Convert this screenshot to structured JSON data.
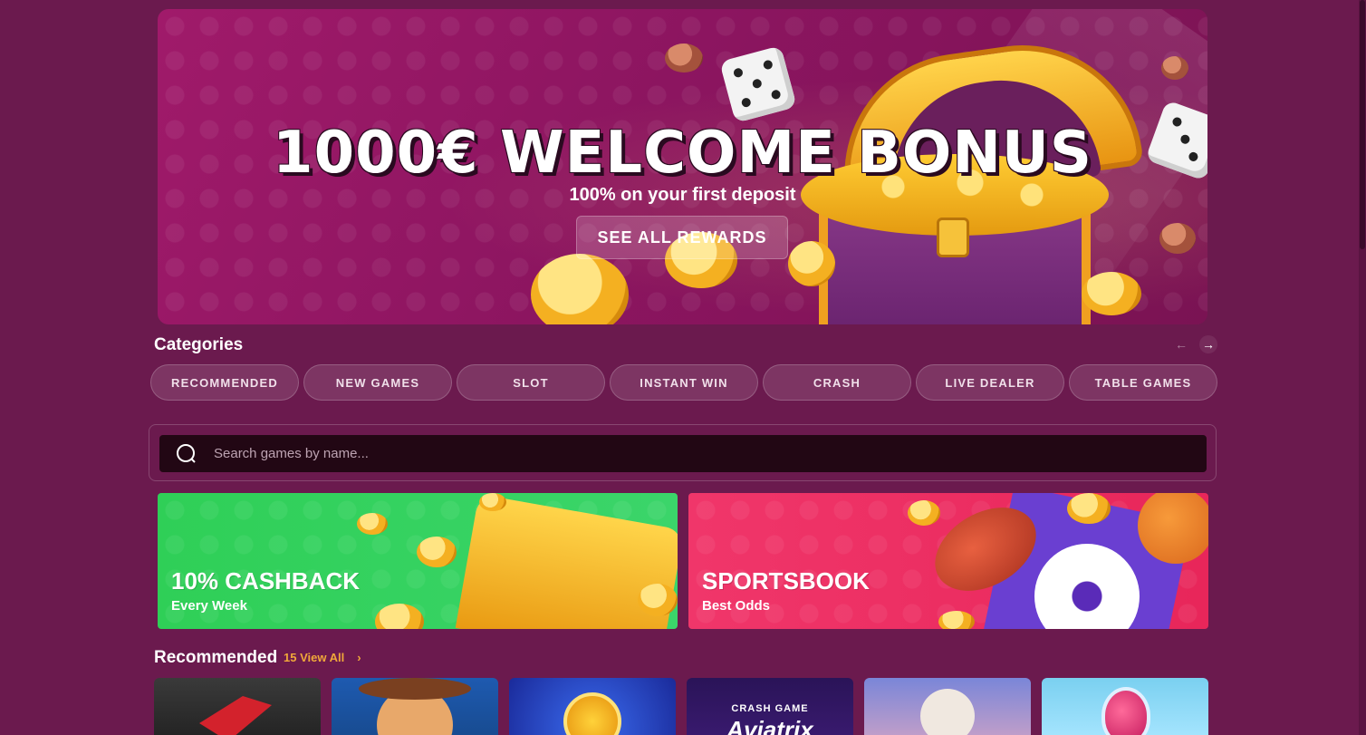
{
  "hero": {
    "title": "1000€ WELCOME BONUS",
    "subtitle": "100% on your first deposit",
    "button_label": "SEE ALL REWARDS"
  },
  "categories": {
    "title": "Categories",
    "prev_icon": "arrow-left-icon",
    "next_icon": "arrow-right-icon",
    "items": [
      {
        "label": "RECOMMENDED"
      },
      {
        "label": "NEW GAMES"
      },
      {
        "label": "SLOT"
      },
      {
        "label": "INSTANT WIN"
      },
      {
        "label": "CRASH"
      },
      {
        "label": "LIVE DEALER"
      },
      {
        "label": "TABLE GAMES"
      }
    ]
  },
  "search": {
    "placeholder": "Search games by name...",
    "value": "",
    "icon": "search-icon"
  },
  "promos": [
    {
      "title": "10% CASHBACK",
      "subtitle": "Every Week",
      "color": "#2fcf57"
    },
    {
      "title": "SPORTSBOOK",
      "subtitle": "Best Odds",
      "color": "#f0366a"
    }
  ],
  "recommended": {
    "title": "Recommended",
    "view_all": "15 View All",
    "view_all_icon": "chevron-right-icon",
    "games": [
      {
        "label": ""
      },
      {
        "label": ""
      },
      {
        "label": ""
      },
      {
        "label": "CRASH GAME",
        "sublabel": "Aviatrix"
      },
      {
        "label": ""
      },
      {
        "label": ""
      }
    ]
  },
  "colors": {
    "background": "#6b1a4e",
    "accent": "#f0a83a",
    "search_bg": "#220714"
  }
}
